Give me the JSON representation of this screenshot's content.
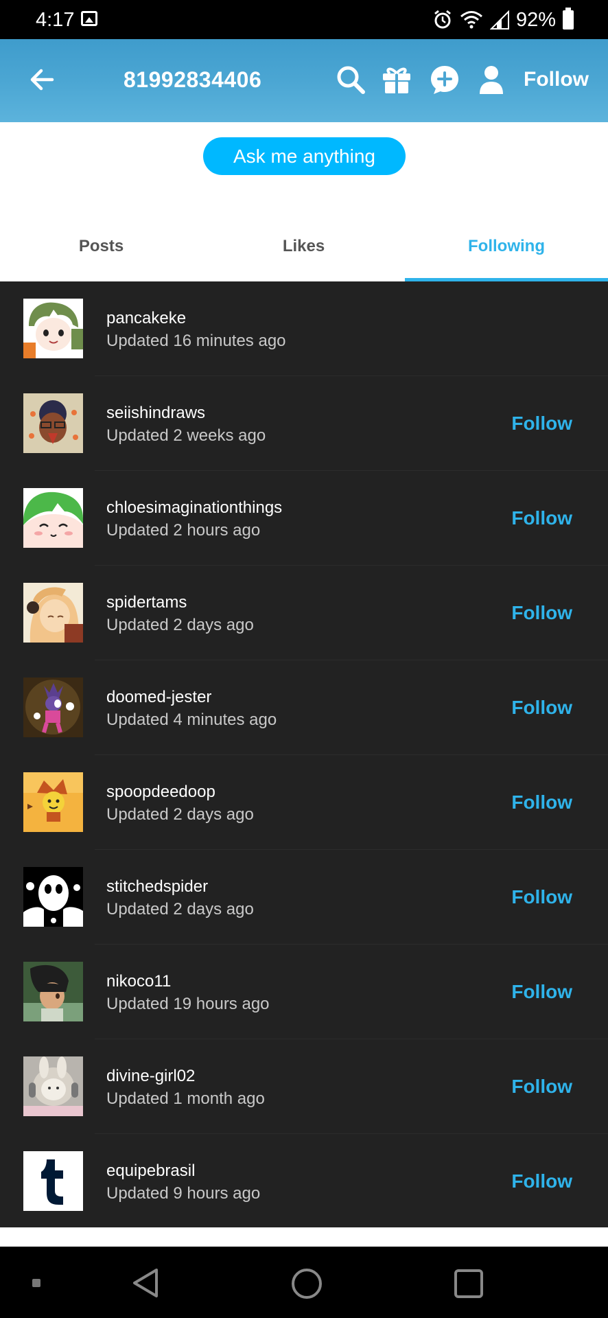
{
  "status_bar": {
    "time": "4:17",
    "battery": "92%"
  },
  "header": {
    "title": "81992834406",
    "follow_label": "Follow"
  },
  "ask_button": "Ask me anything",
  "tabs": [
    {
      "label": "Posts",
      "active": false
    },
    {
      "label": "Likes",
      "active": false
    },
    {
      "label": "Following",
      "active": true
    }
  ],
  "following": [
    {
      "name": "pancakeke",
      "updated": "Updated 16 minutes ago",
      "follow": ""
    },
    {
      "name": "seiishindraws",
      "updated": "Updated 2 weeks ago",
      "follow": "Follow"
    },
    {
      "name": "chloesimaginationthings",
      "updated": "Updated 2 hours ago",
      "follow": "Follow"
    },
    {
      "name": "spidertams",
      "updated": "Updated 2 days ago",
      "follow": "Follow"
    },
    {
      "name": "doomed-jester",
      "updated": "Updated 4 minutes ago",
      "follow": "Follow"
    },
    {
      "name": "spoopdeedoop",
      "updated": "Updated 2 days ago",
      "follow": "Follow"
    },
    {
      "name": "stitchedspider",
      "updated": "Updated 2 days ago",
      "follow": "Follow"
    },
    {
      "name": "nikoco11",
      "updated": "Updated 19 hours ago",
      "follow": "Follow"
    },
    {
      "name": "divine-girl02",
      "updated": "Updated 1 month ago",
      "follow": "Follow"
    },
    {
      "name": "equipebrasil",
      "updated": "Updated 9 hours ago",
      "follow": "Follow"
    }
  ],
  "colors": {
    "accent": "#2fb3ea",
    "ask_button": "#00b8ff",
    "list_bg": "#222222"
  },
  "icons": [
    "back-arrow-icon",
    "search-icon",
    "gift-icon",
    "new-post-icon",
    "account-icon",
    "alarm-icon",
    "wifi-icon",
    "signal-icon",
    "battery-icon",
    "gallery-icon"
  ]
}
